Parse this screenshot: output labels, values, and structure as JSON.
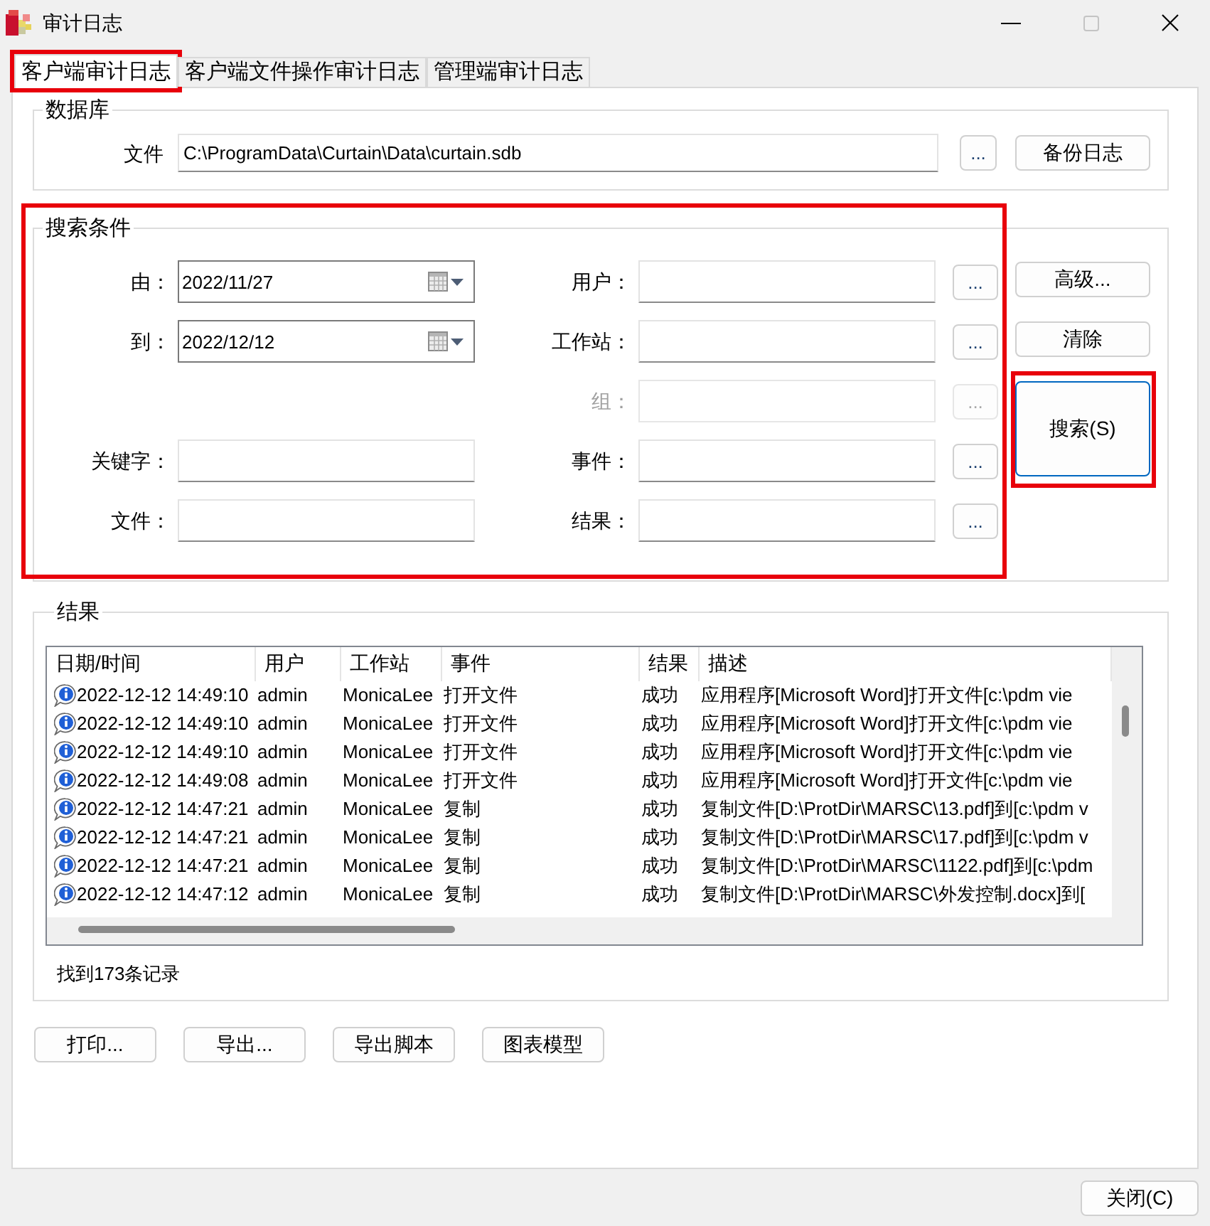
{
  "window": {
    "title": "审计日志",
    "controls": [
      {
        "kind": "minimize",
        "disabled": false
      },
      {
        "kind": "maximize",
        "disabled": true
      },
      {
        "kind": "close",
        "disabled": false
      }
    ]
  },
  "tabs": [
    {
      "label": "客户端审计日志",
      "selected": true,
      "highlighted": true
    },
    {
      "label": "客户端文件操作审计日志",
      "selected": false,
      "highlighted": false
    },
    {
      "label": "管理端审计日志",
      "selected": false,
      "highlighted": false
    }
  ],
  "database": {
    "title": "数据库",
    "file_label": "文件",
    "file_path": "C:\\ProgramData\\Curtain\\Data\\curtain.sdb",
    "browse_button": "...",
    "backup_button": "备份日志"
  },
  "search": {
    "title": "搜索条件",
    "highlighted": true,
    "rows": [
      {
        "left": {
          "label": "由：",
          "kind": "date",
          "value": "2022/11/27"
        },
        "right": {
          "label": "用户：",
          "disabled": false,
          "browse_button": "..."
        }
      },
      {
        "left": {
          "label": "到：",
          "kind": "date",
          "value": "2022/12/12"
        },
        "right": {
          "label": "工作站：",
          "disabled": false,
          "browse_button": "..."
        }
      },
      {
        "right": {
          "label": "组：",
          "disabled": true,
          "browse_button": "..."
        }
      },
      {
        "left": {
          "label": "关键字：",
          "kind": "text"
        },
        "right": {
          "label": "事件：",
          "disabled": false,
          "browse_button": "..."
        }
      },
      {
        "left": {
          "label": "文件：",
          "kind": "text"
        },
        "right": {
          "label": "结果：",
          "disabled": false,
          "browse_button": "..."
        }
      }
    ],
    "buttons": [
      {
        "label": "高级...",
        "kind": "normal",
        "default": false,
        "highlighted": false
      },
      {
        "label": "清除",
        "kind": "normal",
        "default": false,
        "highlighted": false
      },
      {
        "label": "搜索(S)",
        "kind": "tall",
        "default": true,
        "highlighted": true
      }
    ]
  },
  "results": {
    "title": "结果",
    "columns": [
      "日期/时间",
      "用户",
      "工作站",
      "事件",
      "结果",
      "描述"
    ],
    "rows": [
      {
        "time": "2022-12-12 14:49:10",
        "user": "admin",
        "workstation": "MonicaLee",
        "event": "打开文件",
        "result": "成功",
        "description": "应用程序[Microsoft Word]打开文件[c:\\pdm vie"
      },
      {
        "time": "2022-12-12 14:49:10",
        "user": "admin",
        "workstation": "MonicaLee",
        "event": "打开文件",
        "result": "成功",
        "description": "应用程序[Microsoft Word]打开文件[c:\\pdm vie"
      },
      {
        "time": "2022-12-12 14:49:10",
        "user": "admin",
        "workstation": "MonicaLee",
        "event": "打开文件",
        "result": "成功",
        "description": "应用程序[Microsoft Word]打开文件[c:\\pdm vie"
      },
      {
        "time": "2022-12-12 14:49:08",
        "user": "admin",
        "workstation": "MonicaLee",
        "event": "打开文件",
        "result": "成功",
        "description": "应用程序[Microsoft Word]打开文件[c:\\pdm vie"
      },
      {
        "time": "2022-12-12 14:47:21",
        "user": "admin",
        "workstation": "MonicaLee",
        "event": "复制",
        "result": "成功",
        "description": "复制文件[D:\\ProtDir\\MARSC\\13.pdf]到[c:\\pdm v"
      },
      {
        "time": "2022-12-12 14:47:21",
        "user": "admin",
        "workstation": "MonicaLee",
        "event": "复制",
        "result": "成功",
        "description": "复制文件[D:\\ProtDir\\MARSC\\17.pdf]到[c:\\pdm v"
      },
      {
        "time": "2022-12-12 14:47:21",
        "user": "admin",
        "workstation": "MonicaLee",
        "event": "复制",
        "result": "成功",
        "description": "复制文件[D:\\ProtDir\\MARSC\\1122.pdf]到[c:\\pdm"
      },
      {
        "time": "2022-12-12 14:47:12",
        "user": "admin",
        "workstation": "MonicaLee",
        "event": "复制",
        "result": "成功",
        "description": "复制文件[D:\\ProtDir\\MARSC\\外发控制.docx]到["
      }
    ],
    "summary": "找到173条记录"
  },
  "actions": [
    "打印...",
    "导出...",
    "导出脚本",
    "图表模型"
  ],
  "close_button": "关闭(C)"
}
